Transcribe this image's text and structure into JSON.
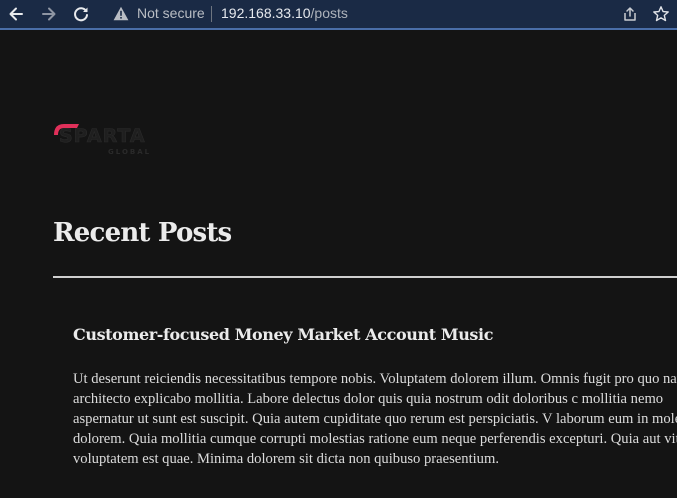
{
  "browser": {
    "security_label": "Not secure",
    "url_host": "192.168.33.10",
    "url_path": "/posts",
    "accent_color": "#4a6ea8"
  },
  "icons": {
    "back": "arrow-left-icon",
    "forward": "arrow-right-icon",
    "reload": "reload-icon",
    "warning": "warning-triangle-icon",
    "share": "share-icon",
    "bookmark": "star-icon"
  },
  "site": {
    "logo_text": "SPARTA",
    "logo_subtext": "GLOBAL",
    "logo_accent_color": "#e0305a"
  },
  "page": {
    "title": "Recent Posts",
    "posts": [
      {
        "title": "Customer-focused Money Market Account Music",
        "body": "Ut deserunt reiciendis necessitatibus tempore nobis. Voluptatem dolorem illum. Omnis fugit pro quo natus architecto explicabo mollitia. Labore delectus dolor quis quia nostrum odit doloribus c mollitia nemo aspernatur ut sunt est suscipit. Quia autem cupiditate quo rerum est perspiciatis. V laborum eum in molestiae dolorem. Quia mollitia cumque corrupti molestias ratione eum neque perferendis excepturi. Quia aut vitae voluptatem est quae. Minima dolorem sit dicta non quibuso praesentium."
      }
    ]
  }
}
